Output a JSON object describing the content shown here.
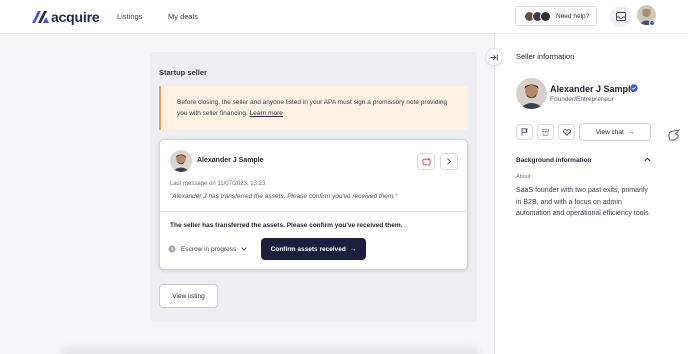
{
  "brand": {
    "name": "acquire",
    "color": "#1c2a52",
    "accent": "#3d5ae0"
  },
  "nav": {
    "listings": "Listings",
    "my_deals": "My deals",
    "help": "Need help?"
  },
  "deal": {
    "panel_title": "Startup seller",
    "notice_text": "Before closing, the seller and anyone listed in your APA must sign a promissory note providing you with seller financing.",
    "notice_link": "Learn more",
    "conversation": {
      "name": "Alexander J Sample",
      "last_message": "Last message on 11/07/2023, 13:23",
      "quote": "\"Alexander J has transferred the assets. Please confirm you've received them.\"",
      "transfer_message": "The seller has transferred the assets. Please confirm you've received them.",
      "escrow_status": "Escrow in progress",
      "confirm_button": "Confirm assets received",
      "confirm_arrow": "→"
    },
    "view_listing": "View listing"
  },
  "seller_panel": {
    "title": "Seller information",
    "name": "Alexander J Sample",
    "role": "Founder/Entrepreneur",
    "view_chat": "View chat",
    "view_chat_arrow": "→",
    "background_title": "Background information",
    "about_label": "About",
    "about_text": "SaaS founder with two past exits, primarily in B2B, and with a focus on admin automation and operational efficiency tools"
  },
  "icons": {
    "logo": "acquire-logo-icon",
    "inbox": "inbox-icon",
    "collapse": "collapse-panel-icon",
    "flag": "flag-icon",
    "archive": "archive-icon",
    "heart": "heart-icon",
    "verified": "verified-badge-icon",
    "refresh": "refresh-icon",
    "chevron": "chevron-right-icon",
    "clock": "clock-icon"
  }
}
